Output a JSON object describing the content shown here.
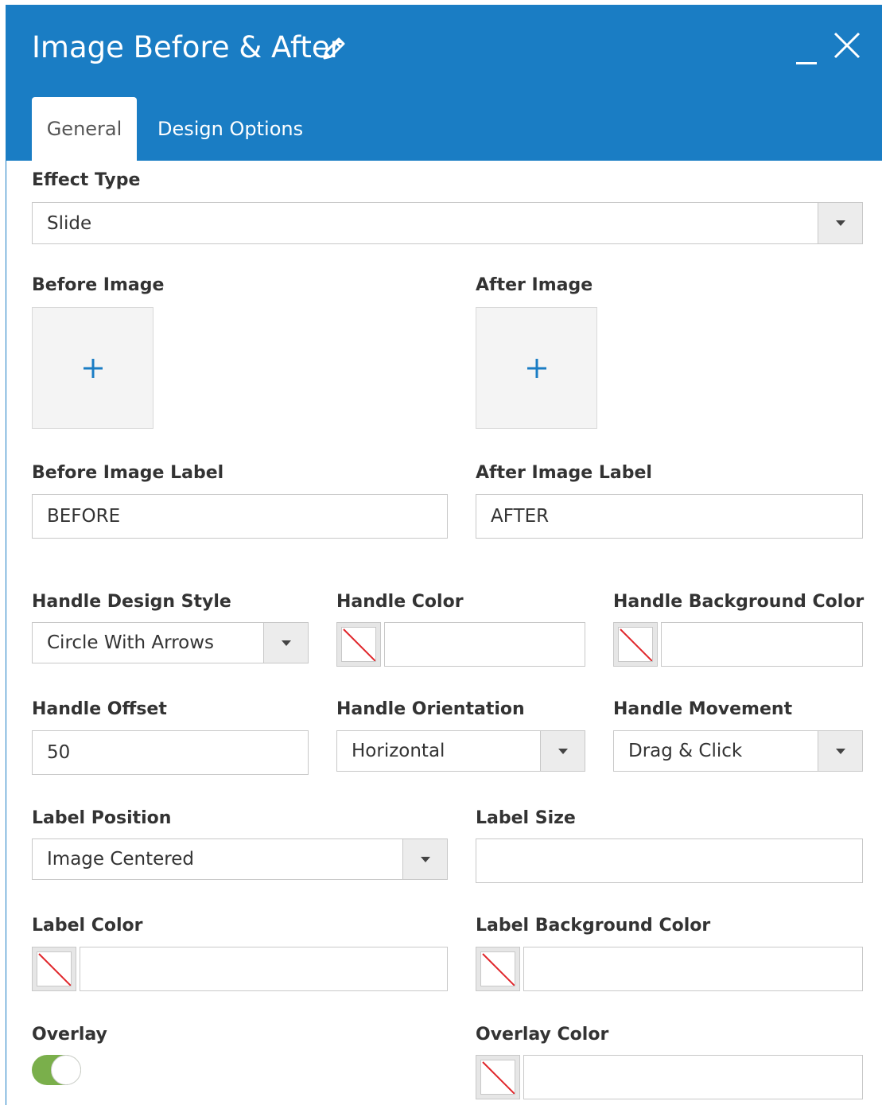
{
  "window": {
    "title": "Image Before & After",
    "icons": {
      "edit": "pencil-icon",
      "minimize": "minimize-icon",
      "close": "close-icon"
    }
  },
  "tabs": [
    {
      "label": "General",
      "active": true
    },
    {
      "label": "Design Options",
      "active": false
    }
  ],
  "fields": {
    "effect_type": {
      "label": "Effect Type",
      "value": "Slide"
    },
    "before_image": {
      "label": "Before Image"
    },
    "after_image": {
      "label": "After Image"
    },
    "before_image_label": {
      "label": "Before Image Label",
      "value": "BEFORE"
    },
    "after_image_label": {
      "label": "After Image Label",
      "value": "AFTER"
    },
    "handle_design_style": {
      "label": "Handle Design Style",
      "value": "Circle With Arrows"
    },
    "handle_color": {
      "label": "Handle Color",
      "value": ""
    },
    "handle_background_color": {
      "label": "Handle Background Color",
      "value": ""
    },
    "handle_offset": {
      "label": "Handle Offset",
      "value": "50"
    },
    "handle_orientation": {
      "label": "Handle Orientation",
      "value": "Horizontal"
    },
    "handle_movement": {
      "label": "Handle Movement",
      "value": "Drag & Click"
    },
    "label_position": {
      "label": "Label Position",
      "value": "Image Centered"
    },
    "label_size": {
      "label": "Label Size",
      "value": ""
    },
    "label_color": {
      "label": "Label Color",
      "value": ""
    },
    "label_background_color": {
      "label": "Label Background Color",
      "value": ""
    },
    "overlay": {
      "label": "Overlay",
      "enabled": true
    },
    "overlay_color": {
      "label": "Overlay Color",
      "value": ""
    }
  },
  "colors": {
    "header_bg": "#1a7dc4",
    "toggle_on": "#7aaf4b",
    "plus": "#1a7dc4",
    "no_color_slash": "#e0262b"
  }
}
